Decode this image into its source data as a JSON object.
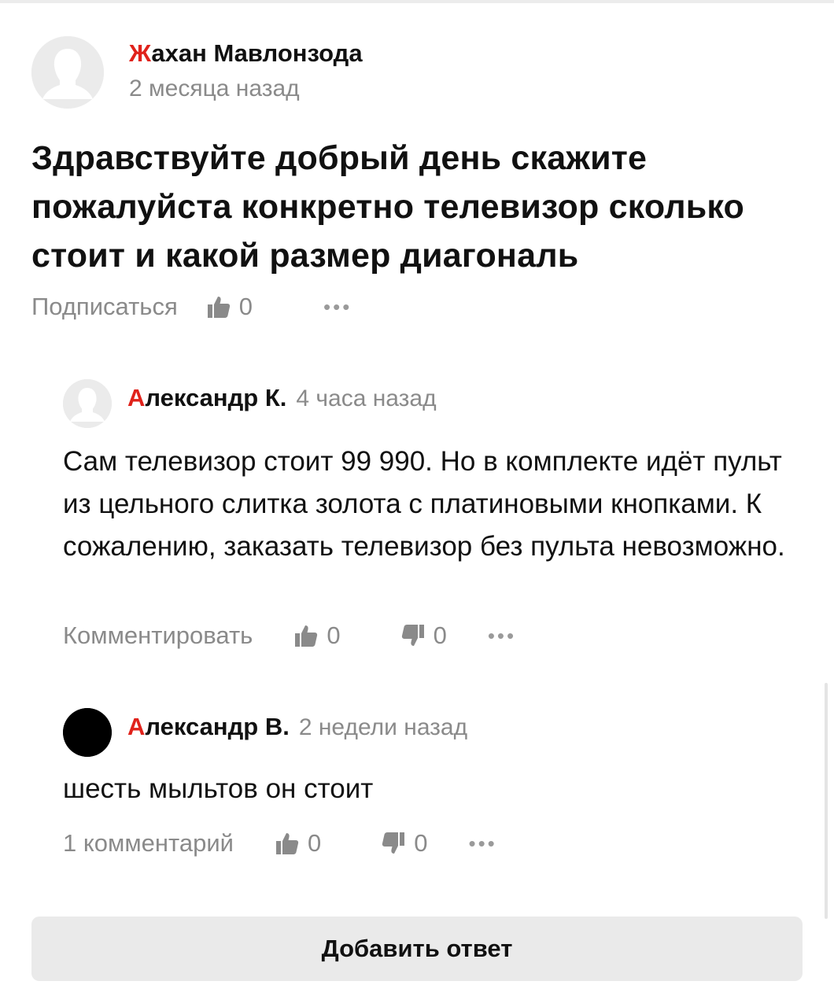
{
  "question": {
    "author": "Жахан Мавлонзода",
    "time": "2 месяца назад",
    "title": "Здравствуйте добрый день скажите пожалуйста конкретно телевизор сколько стоит и какой размер диагональ",
    "subscribe_label": "Подписаться",
    "likes": "0",
    "more_label": "•••"
  },
  "answers": [
    {
      "author": "Александр К.",
      "time": "4 часа назад",
      "text": "Сам телевизор стоит 99 990. Но в комплекте идёт пульт из цельного слитка золота с платиновыми кнопками. К сожалению, заказать телевизор без пульта невозможно.",
      "comment_label": "Комментировать",
      "likes": "0",
      "dislikes": "0",
      "more_label": "•••",
      "avatar": "default-silhouette"
    },
    {
      "author": "Александр В.",
      "time": "2 недели назад",
      "text": "шесть мыльтов он стоит",
      "comment_label": "1 комментарий",
      "likes": "0",
      "dislikes": "0",
      "more_label": "•••",
      "avatar": "black-circle"
    }
  ],
  "add_answer_label": "Добавить ответ",
  "colors": {
    "accent_first_letter": "#e0221b",
    "muted_text": "#8a8a8a",
    "button_bg": "#eaeaea"
  },
  "icons": {
    "like": "thumbs-up-icon",
    "dislike": "thumbs-down-icon",
    "more": "more-dots-icon",
    "avatar_default": "user-silhouette-icon"
  }
}
